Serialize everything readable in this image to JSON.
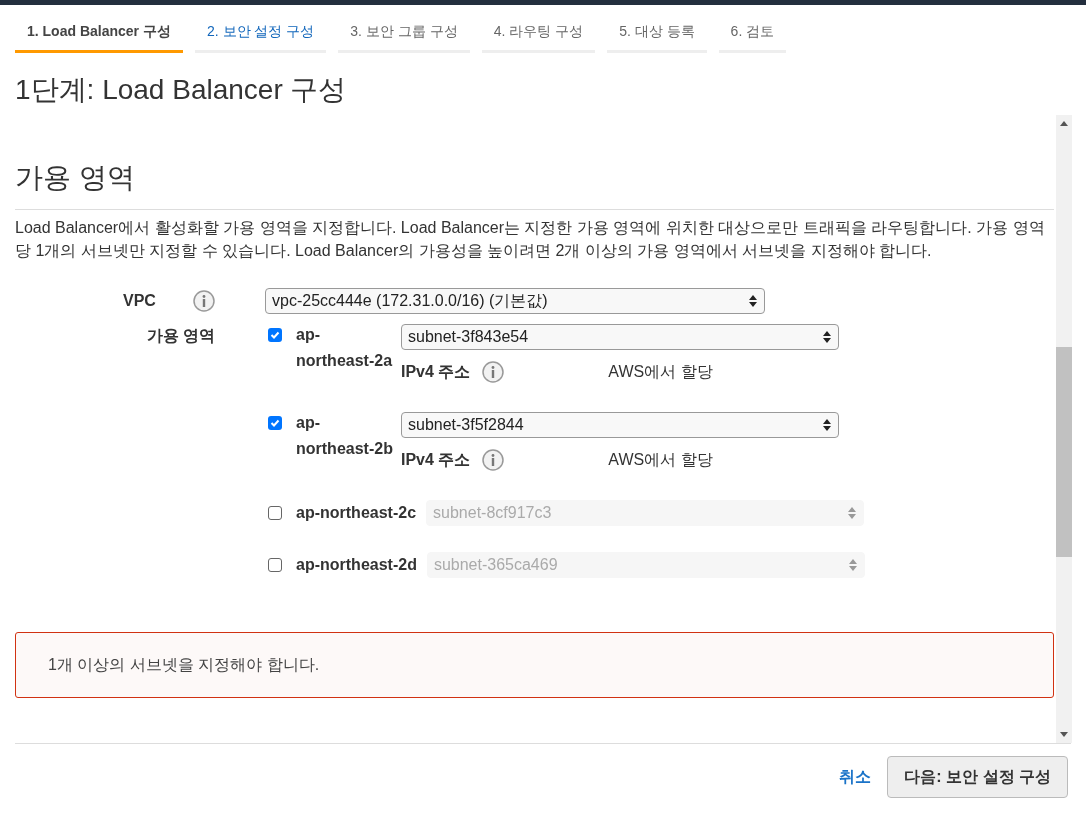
{
  "tabs": [
    {
      "label": "1. Load Balancer 구성",
      "selected": true,
      "hovered": false
    },
    {
      "label": "2. 보안 설정 구성",
      "selected": false,
      "hovered": true
    },
    {
      "label": "3. 보안 그룹 구성",
      "selected": false,
      "hovered": false
    },
    {
      "label": "4. 라우팅 구성",
      "selected": false,
      "hovered": false
    },
    {
      "label": "5. 대상 등록",
      "selected": false,
      "hovered": false
    },
    {
      "label": "6. 검토",
      "selected": false,
      "hovered": false
    }
  ],
  "page_title": "1단계: Load Balancer 구성",
  "section": {
    "title": "가용 영역",
    "description": "Load Balancer에서 활성화할 가용 영역을 지정합니다. Load Balancer는 지정한 가용 영역에 위치한 대상으로만 트래픽을 라우팅합니다. 가용 영역당 1개의 서브넷만 지정할 수 있습니다. Load Balancer의 가용성을 높이려면 2개 이상의 가용 영역에서 서브넷을 지정해야 합니다.",
    "vpc": {
      "label": "VPC",
      "value": "vpc-25cc444e (172.31.0.0/16) (기본값)"
    },
    "zones_label": "가용 영역",
    "zones": [
      {
        "name": "ap-northeast-2a",
        "checked": true,
        "subnet": "subnet-3f843e54",
        "ipv4_label": "IPv4 주소",
        "ipv4_value": "AWS에서 할당"
      },
      {
        "name": "ap-northeast-2b",
        "checked": true,
        "subnet": "subnet-3f5f2844",
        "ipv4_label": "IPv4 주소",
        "ipv4_value": "AWS에서 할당"
      },
      {
        "name": "ap-northeast-2c",
        "checked": false,
        "subnet": "subnet-8cf917c3"
      },
      {
        "name": "ap-northeast-2d",
        "checked": false,
        "subnet": "subnet-365ca469"
      }
    ],
    "error": "1개 이상의 서브넷을 지정해야 합니다."
  },
  "footer": {
    "cancel": "취소",
    "next": "다음: 보안 설정 구성"
  }
}
